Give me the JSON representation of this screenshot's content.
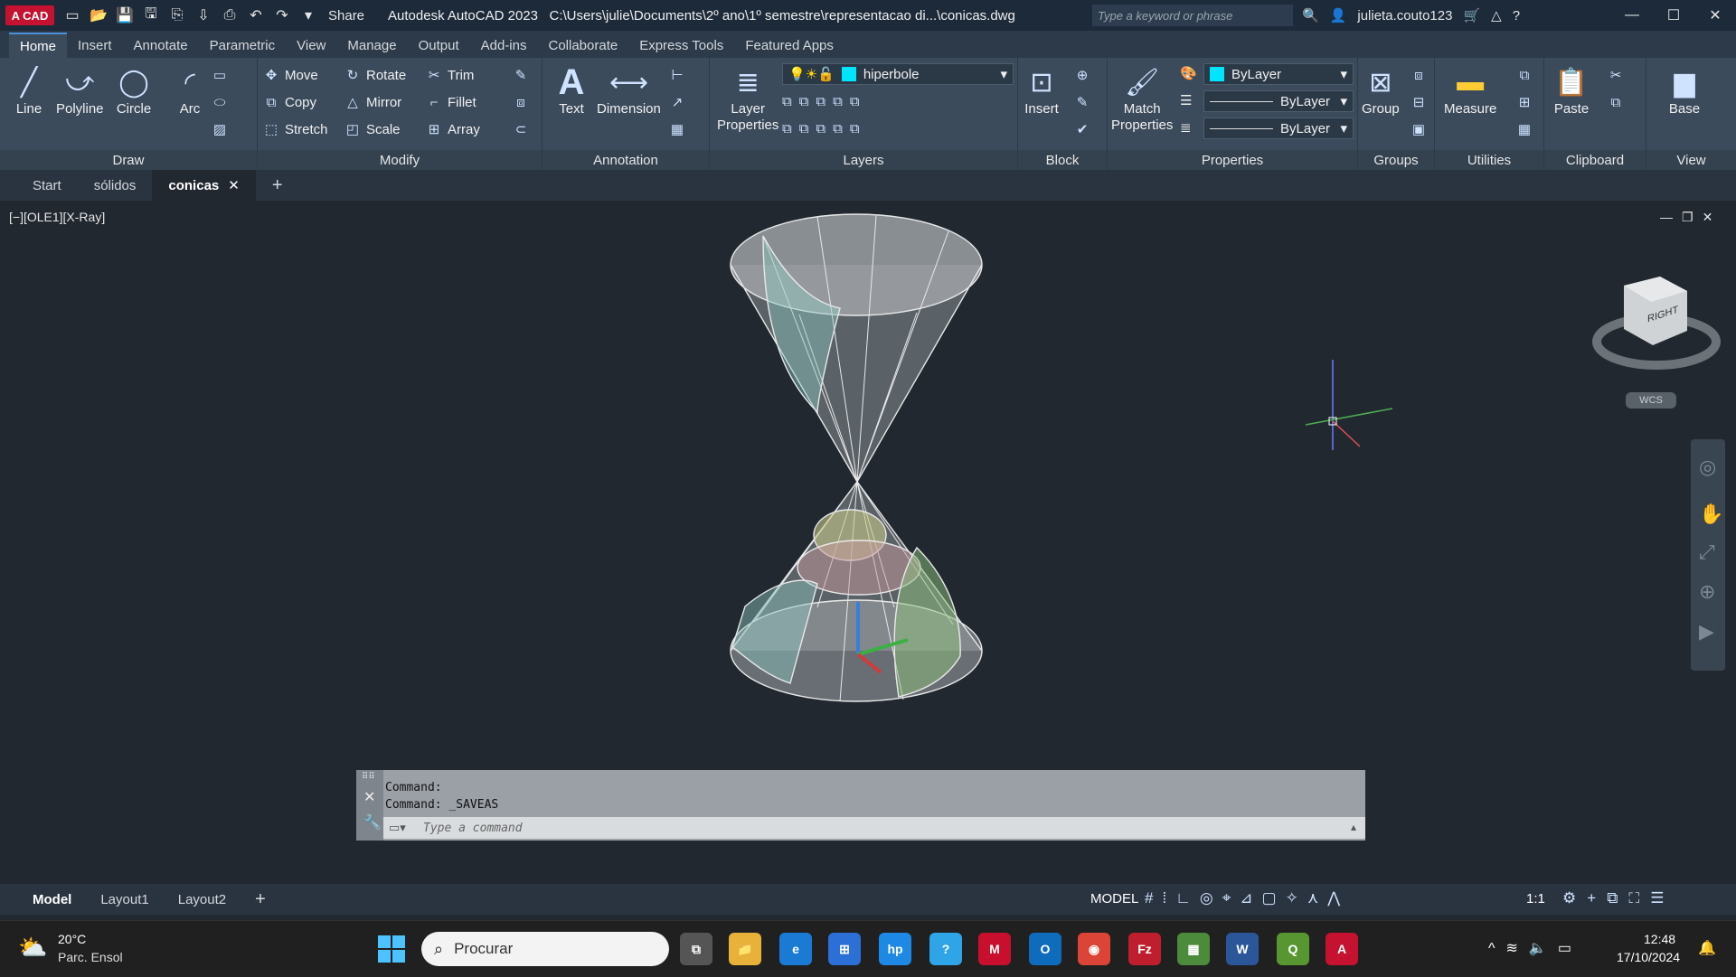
{
  "titlebar": {
    "logo": "A CAD",
    "share": "Share",
    "app_title": "Autodesk AutoCAD 2023",
    "file_path": "C:\\Users\\julie\\Documents\\2º ano\\1º semestre\\representacao di...\\conicas.dwg",
    "search_placeholder": "Type a keyword or phrase",
    "user": "julieta.couto123"
  },
  "ribbon_tabs": [
    "Home",
    "Insert",
    "Annotate",
    "Parametric",
    "View",
    "Manage",
    "Output",
    "Add-ins",
    "Collaborate",
    "Express Tools",
    "Featured Apps"
  ],
  "draw": {
    "line": "Line",
    "polyline": "Polyline",
    "circle": "Circle",
    "arc": "Arc",
    "panel": "Draw"
  },
  "modify": {
    "move": "Move",
    "rotate": "Rotate",
    "trim": "Trim",
    "copy": "Copy",
    "mirror": "Mirror",
    "fillet": "Fillet",
    "stretch": "Stretch",
    "scale": "Scale",
    "array": "Array",
    "panel": "Modify"
  },
  "annotation": {
    "text": "Text",
    "dimension": "Dimension",
    "panel": "Annotation"
  },
  "layers": {
    "props_line1": "Layer",
    "props_line2": "Properties",
    "current": "hiperbole",
    "panel": "Layers",
    "color": "#00e5ff"
  },
  "block": {
    "insert": "Insert",
    "panel": "Block"
  },
  "properties": {
    "match1": "Match",
    "match2": "Properties",
    "color": "ByLayer",
    "linetype": "ByLayer",
    "lineweight": "ByLayer",
    "panel": "Properties",
    "swatch": "#00e5ff"
  },
  "groups": {
    "group": "Group",
    "panel": "Groups"
  },
  "utilities": {
    "measure": "Measure",
    "panel": "Utilities"
  },
  "clipboard": {
    "paste": "Paste",
    "panel": "Clipboard"
  },
  "view": {
    "base": "Base",
    "panel": "View"
  },
  "doc_tabs": [
    "Start",
    "sólidos",
    "conicas"
  ],
  "viewport": {
    "label": "[−][OLE1][X-Ray]",
    "viewcube_face": "RIGHT",
    "wcs": "WCS"
  },
  "command": {
    "line1": "Command:",
    "line2": "Command:  _SAVEAS",
    "placeholder": "Type a command"
  },
  "layouts": [
    "Model",
    "Layout1",
    "Layout2"
  ],
  "status": {
    "model": "MODEL",
    "scale": "1:1"
  },
  "taskbar": {
    "temp": "20°C",
    "weather": "Parc. Ensol",
    "search": "Procurar",
    "time": "12:48",
    "date": "17/10/2024"
  }
}
